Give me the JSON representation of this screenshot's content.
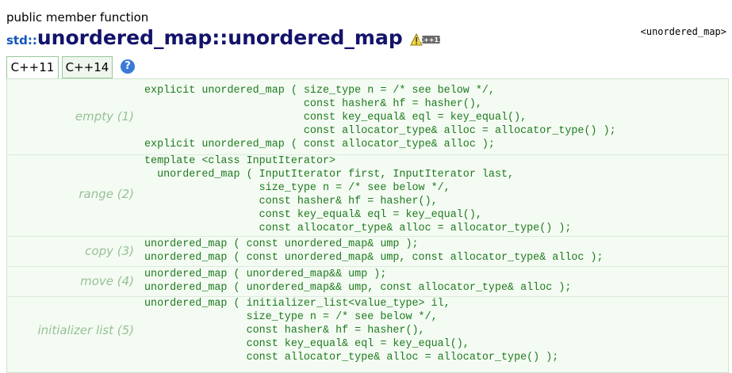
{
  "header": {
    "kind": "public member function",
    "namespace": "std::",
    "title": "unordered_map::unordered_map",
    "badge_label": "C++11",
    "header_link": "<unordered_map>"
  },
  "tabs": {
    "items": [
      {
        "label": "C++11",
        "active": true
      },
      {
        "label": "C++14",
        "active": false
      }
    ],
    "help_label": "?"
  },
  "sections": [
    {
      "label": "empty (1)",
      "code": "explicit unordered_map ( size_type n = /* see below */,\n                         const hasher& hf = hasher(),\n                         const key_equal& eql = key_equal(),\n                         const allocator_type& alloc = allocator_type() );\nexplicit unordered_map ( const allocator_type& alloc );"
    },
    {
      "label": "range (2)",
      "code": "template <class InputIterator>\n  unordered_map ( InputIterator first, InputIterator last,\n                  size_type n = /* see below */,\n                  const hasher& hf = hasher(),\n                  const key_equal& eql = key_equal(),\n                  const allocator_type& alloc = allocator_type() );"
    },
    {
      "label": "copy (3)",
      "code": "unordered_map ( const unordered_map& ump );\nunordered_map ( const unordered_map& ump, const allocator_type& alloc );"
    },
    {
      "label": "move (4)",
      "code": "unordered_map ( unordered_map&& ump );\nunordered_map ( unordered_map&& ump, const allocator_type& alloc );"
    },
    {
      "label": "initializer list (5)",
      "code": "unordered_map ( initializer_list<value_type> il,\n                size_type n = /* see below */,\n                const hasher& hf = hasher(),\n                const key_equal& eql = key_equal(),\n                const allocator_type& alloc = allocator_type() );"
    }
  ]
}
